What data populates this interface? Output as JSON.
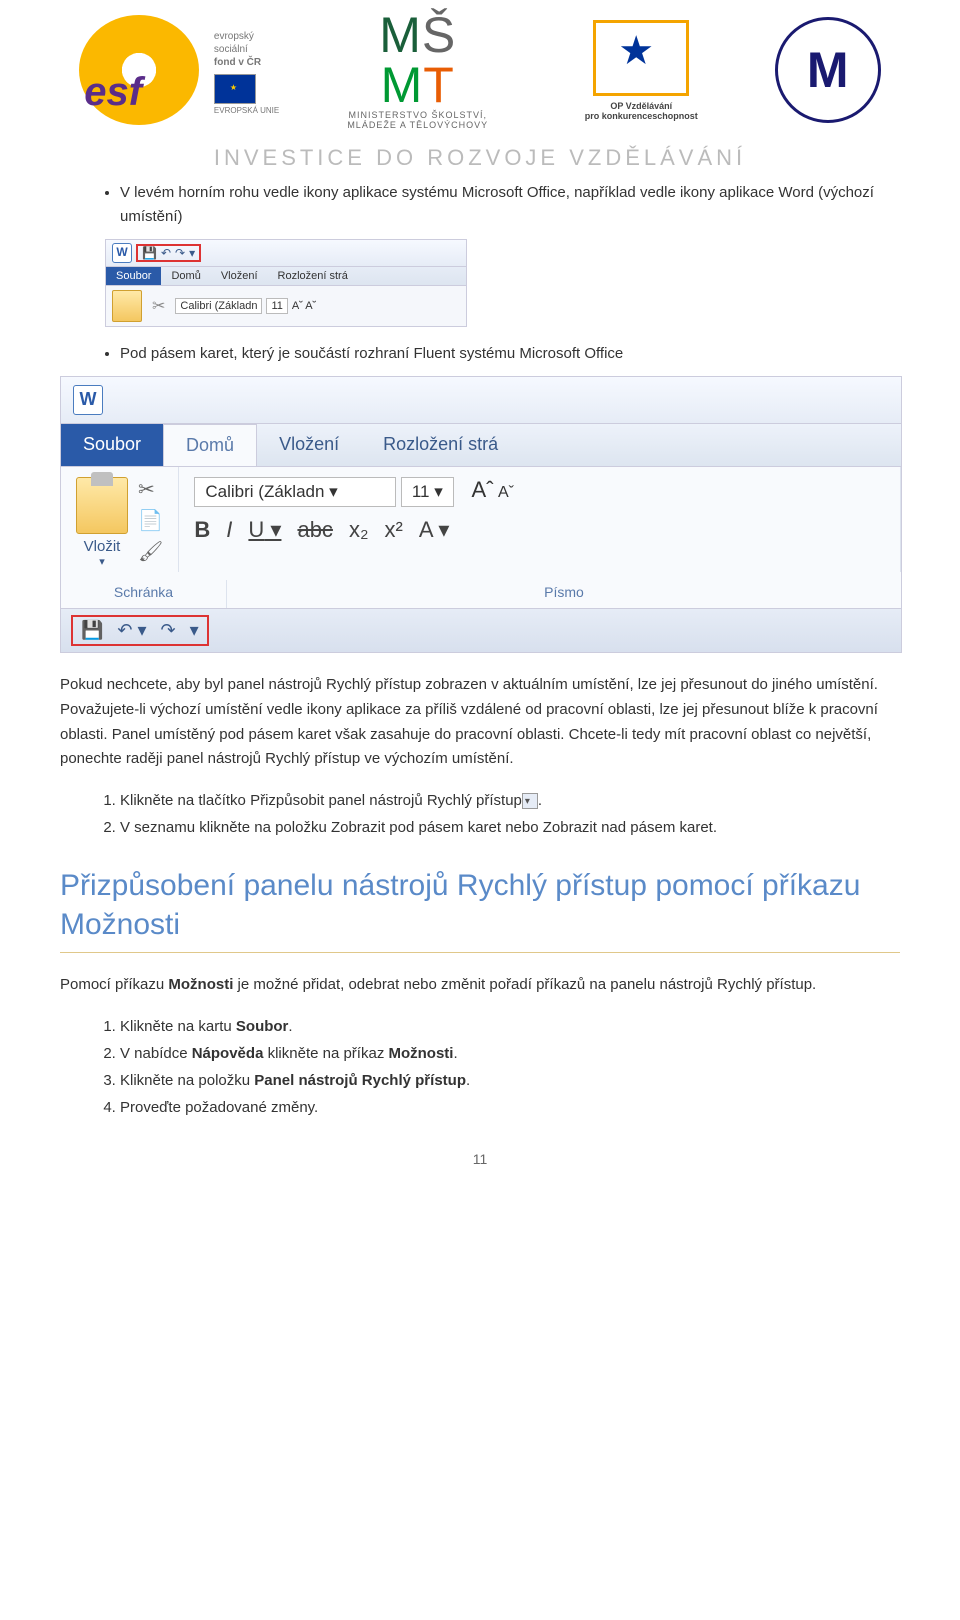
{
  "header": {
    "esf_label": "esf",
    "esf_text1": "evropský",
    "esf_text2": "sociální",
    "esf_text3": "fond v ČR",
    "esf_eu": "EVROPSKÁ UNIE",
    "msmt_line1": "MINISTERSTVO ŠKOLSTVÍ,",
    "msmt_line2": "MLÁDEŽE A TĚLOVÝCHOVY",
    "op_line1": "OP Vzdělávání",
    "op_line2": "pro konkurenceschopnost",
    "mu_inner": "M",
    "invest": "INVESTICE DO ROZVOJE VZDĚLÁVÁNÍ"
  },
  "bullets": {
    "b1": "V levém horním rohu vedle ikony aplikace systému Microsoft Office, například vedle ikony aplikace Word      (výchozí umístění)",
    "b2": "Pod pásem karet, který je součástí rozhraní Fluent systému Microsoft Office"
  },
  "ribbon_small": {
    "tabs": {
      "file": "Soubor",
      "home": "Domů",
      "insert": "Vložení",
      "layout": "Rozložení strá"
    },
    "font": "Calibri (Základn",
    "size": "11",
    "aa": "A˘ A˘"
  },
  "ribbon_big": {
    "tabs": {
      "file": "Soubor",
      "home": "Domů",
      "insert": "Vložení",
      "layout": "Rozložení strá"
    },
    "paste": "Vložit",
    "group_clip": "Schránka",
    "group_font": "Písmo",
    "font": "Calibri (Základn",
    "size": "11",
    "aa_big": "Aˆ",
    "aa_sm": "Aˇ",
    "bold": "B",
    "italic": "I",
    "under": "U",
    "strike": "abc",
    "sub": "x₂",
    "sup": "x²",
    "aa2": "A"
  },
  "para1": "Pokud nechcete, aby byl panel nástrojů Rychlý přístup zobrazen v aktuálním umístění, lze jej přesunout do jiného umístění. Považujete-li výchozí umístění vedle ikony aplikace za příliš vzdálené od pracovní oblasti, lze jej přesunout blíže k pracovní oblasti. Panel umístěný pod pásem karet však zasahuje do pracovní oblasti. Chcete-li tedy mít pracovní oblast co největší, ponechte raději panel nástrojů Rychlý přístup ve výchozím umístění.",
  "ol1": {
    "i1a": "Klikněte na tlačítko Přizpůsobit panel nástrojů Rychlý přístup",
    "i1b": ".",
    "i2": "V seznamu klikněte na položku Zobrazit pod pásem karet nebo Zobrazit nad pásem karet."
  },
  "h2": "Přizpůsobení panelu nástrojů Rychlý přístup pomocí příkazu Možnosti",
  "para2a": "Pomocí příkazu ",
  "para2b": "Možnosti",
  "para2c": " je možné přidat, odebrat nebo změnit pořadí příkazů na panelu nástrojů Rychlý přístup.",
  "ol2": {
    "i1a": "Klikněte na kartu ",
    "i1b": "Soubor",
    "i1c": ".",
    "i2a": "V nabídce ",
    "i2b": "Nápověda",
    "i2c": " klikněte na příkaz ",
    "i2d": "Možnosti",
    "i2e": ".",
    "i3a": "Klikněte na položku ",
    "i3b": "Panel nástrojů Rychlý přístup",
    "i3c": ".",
    "i4": "Proveďte požadované změny."
  },
  "pagenum": "11"
}
